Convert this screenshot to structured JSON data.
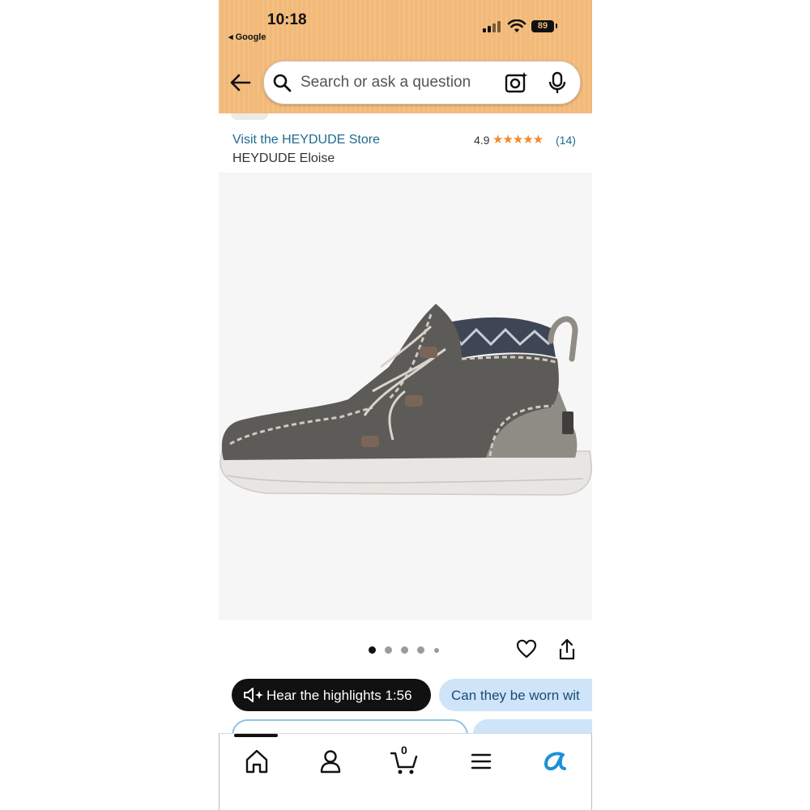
{
  "status_bar": {
    "time": "10:18",
    "back_to_app": "◂ Google",
    "battery": "89"
  },
  "search": {
    "placeholder": "Search or ask a question"
  },
  "product": {
    "store_link": "Visit the HEYDUDE Store",
    "name": "HEYDUDE Eloise",
    "rating": "4.9",
    "stars": "★★★★★",
    "rating_count": "(14)"
  },
  "gallery": {
    "image_count": 5,
    "active_index": 0
  },
  "chips": {
    "highlights_label": "Hear the highlights 1:56",
    "question_label": "Can they be worn wit"
  },
  "nav": {
    "items": [
      "home",
      "account",
      "cart",
      "menu",
      "rufus"
    ],
    "cart_count": "0"
  },
  "colors": {
    "header_bg": "#f2b978",
    "link": "#1f6b8f",
    "star": "#f08a2b",
    "chip_dark": "#111111",
    "chip_light": "#cfe4f8",
    "rufus_accent": "#1e90d6"
  }
}
